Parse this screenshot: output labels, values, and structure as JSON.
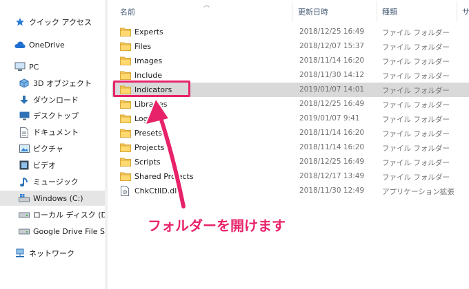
{
  "nav": {
    "items": [
      {
        "label": "クイック アクセス",
        "icon": "star-icon"
      },
      {
        "label": "OneDrive",
        "icon": "cloud-icon"
      },
      {
        "label": "PC",
        "icon": "pc-icon"
      },
      {
        "label": "3D オブジェクト",
        "icon": "3d-objects-icon"
      },
      {
        "label": "ダウンロード",
        "icon": "download-icon"
      },
      {
        "label": "デスクトップ",
        "icon": "desktop-icon"
      },
      {
        "label": "ドキュメント",
        "icon": "document-icon"
      },
      {
        "label": "ピクチャ",
        "icon": "pictures-icon"
      },
      {
        "label": "ビデオ",
        "icon": "video-icon"
      },
      {
        "label": "ミュージック",
        "icon": "music-icon"
      },
      {
        "label": "Windows (C:)",
        "icon": "windows-drive-icon",
        "selected": true
      },
      {
        "label": "ローカル ディスク (D:)",
        "icon": "drive-icon"
      },
      {
        "label": "Google Drive File St",
        "icon": "drive-icon"
      },
      {
        "label": "ネットワーク",
        "icon": "network-icon"
      }
    ]
  },
  "columns": {
    "name": "名前",
    "date": "更新日時",
    "type": "種類",
    "size": "サ"
  },
  "files": [
    {
      "name": "Experts",
      "date": "2018/12/25 16:49",
      "type": "ファイル フォルダー",
      "kind": "folder"
    },
    {
      "name": "Files",
      "date": "2018/12/07 15:37",
      "type": "ファイル フォルダー",
      "kind": "folder"
    },
    {
      "name": "Images",
      "date": "2018/11/14 16:20",
      "type": "ファイル フォルダー",
      "kind": "folder"
    },
    {
      "name": "Include",
      "date": "2018/11/30 14:12",
      "type": "ファイル フォルダー",
      "kind": "folder"
    },
    {
      "name": "Indicators",
      "date": "2019/01/07 14:01",
      "type": "ファイル フォルダー",
      "kind": "folder",
      "selected": true
    },
    {
      "name": "Libraries",
      "date": "2018/12/25 16:49",
      "type": "ファイル フォルダー",
      "kind": "folder"
    },
    {
      "name": "Logs",
      "date": "2019/01/07 9:41",
      "type": "ファイル フォルダー",
      "kind": "folder"
    },
    {
      "name": "Presets",
      "date": "2018/11/14 16:20",
      "type": "ファイル フォルダー",
      "kind": "folder"
    },
    {
      "name": "Projects",
      "date": "2018/11/14 16:20",
      "type": "ファイル フォルダー",
      "kind": "folder"
    },
    {
      "name": "Scripts",
      "date": "2018/12/25 16:49",
      "type": "ファイル フォルダー",
      "kind": "folder"
    },
    {
      "name": "Shared Projects",
      "date": "2018/12/17 13:49",
      "type": "ファイル フォルダー",
      "kind": "folder"
    },
    {
      "name": "ChkCtlID.dll",
      "date": "2018/11/30 12:49",
      "type": "アプリケーション拡張",
      "kind": "dll"
    }
  ],
  "annotation": {
    "text": "フォルダーを開けます",
    "color": "#e8236a"
  }
}
